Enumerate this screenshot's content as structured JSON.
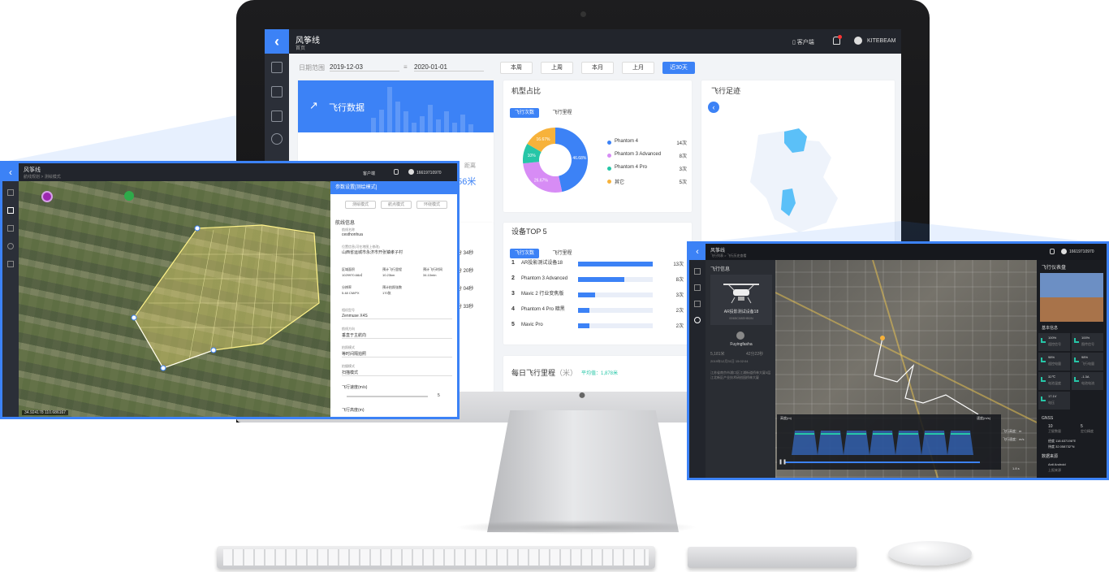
{
  "app": {
    "name": "风筝线",
    "subtitle": "首页",
    "client_label": "客户端",
    "user": "KITEBEAM"
  },
  "date_range": {
    "label": "日期范围",
    "start": "2019-12-03",
    "separator": "≡",
    "end": "2020-01-01"
  },
  "range_buttons": [
    {
      "label": "本周",
      "active": false
    },
    {
      "label": "上周",
      "active": false
    },
    {
      "label": "本月",
      "active": false
    },
    {
      "label": "上月",
      "active": false
    },
    {
      "label": "近30天",
      "active": true
    }
  ],
  "flight_data_card": {
    "title": "飞行数据",
    "partial_value": "356米",
    "partial_label": "距离"
  },
  "model_share": {
    "title": "机型占比",
    "tabs": [
      "飞行次数",
      "飞行里程"
    ],
    "pie_labels": [
      "46.68%",
      "26.67%",
      "16.67%",
      "10%"
    ],
    "legend": [
      {
        "name": "Phantom 4",
        "value": "14次",
        "color": "#3c82f6"
      },
      {
        "name": "Phantom 3 Advanced",
        "value": "8次",
        "color": "#d78cf5"
      },
      {
        "name": "Phantom 4 Pro",
        "value": "3次",
        "color": "#26c6a7"
      },
      {
        "name": "其它",
        "value": "5次",
        "color": "#f7b23b"
      }
    ]
  },
  "chart_data": {
    "type": "pie",
    "title": "机型占比",
    "categories": [
      "Phantom 4",
      "Phantom 3 Advanced",
      "Phantom 4 Pro",
      "其它"
    ],
    "values": [
      14,
      8,
      3,
      5
    ],
    "labels": [
      "46.68%",
      "26.67%",
      "10%",
      "16.67%"
    ]
  },
  "flight_track": {
    "title": "飞行足迹"
  },
  "device_top5": {
    "title": "设备TOP 5",
    "tabs": [
      "飞行次数",
      "飞行里程"
    ],
    "rows": [
      {
        "rank": "1",
        "name": "AR投影测试设备18",
        "value": "13次",
        "fraction": 1.0
      },
      {
        "rank": "2",
        "name": "Phantom 3 Advanced",
        "value": "8次",
        "fraction": 0.62
      },
      {
        "rank": "3",
        "name": "Mavic 2 行业变焦版",
        "value": "3次",
        "fraction": 0.23
      },
      {
        "rank": "4",
        "name": "Phantom 4 Pro 暗黑",
        "value": "2次",
        "fraction": 0.15
      },
      {
        "rank": "5",
        "name": "Mavic Pro",
        "value": "2次",
        "fraction": 0.15
      }
    ]
  },
  "daily_mileage": {
    "title": "每日飞行里程",
    "unit": "（米）",
    "avg": "平均值：1,878米"
  },
  "partial_durations": [
    "分 34秒",
    "分 20秒",
    "分 04秒",
    "分 33秒"
  ],
  "left_window": {
    "app_name": "风筝线",
    "breadcrumb": "航线规划 > 测绘模式",
    "client_label": "客户端",
    "phone": "16619710970",
    "panel_title": "参数设置[测绘模式]",
    "mode_buttons": [
      "测绘模式",
      "航点模式",
      "环绕模式"
    ],
    "section": "航线信息",
    "fields": [
      {
        "label": "航线名称",
        "value": "cesthonhua"
      },
      {
        "label": "位置信息(可在地图上修改)",
        "value": "山西省运城市永济市开张镇孝子村"
      }
    ],
    "stats": [
      {
        "label": "区域面积",
        "value": "1029970.68㎡"
      },
      {
        "label": "预计飞行里程",
        "value": "10.23km"
      },
      {
        "label": "预计飞行时间",
        "value": "34.10min"
      },
      {
        "label": "分辨率",
        "value": "5.48 CM/PX"
      },
      {
        "label": "预计拍照张数",
        "value": "170张"
      }
    ],
    "selects": [
      {
        "label": "相机型号",
        "value": "Zenmuse X4S"
      },
      {
        "label": "航线方向",
        "value": "垂直于主航向"
      },
      {
        "label": "拍照模式",
        "value": "等时间隔拍照"
      },
      {
        "label": "拍摄模式",
        "value": "扫描模式"
      }
    ],
    "sliders": [
      {
        "label": "飞行速度(m/s)",
        "value": "5"
      },
      {
        "label": "飞行高度(m)",
        "value": ""
      }
    ],
    "coords": "34.924178    110.686167"
  },
  "right_window": {
    "app_name": "风筝线",
    "breadcrumb": "飞行列表 > 飞行历史查看",
    "phone": "16619710970",
    "left_panel_title": "飞行信息",
    "device_name": "AR投影测试设备18",
    "serial": "0065C08EHB0N",
    "pilot": "Fuyingfasha",
    "distance": "5,181米",
    "duration": "42分22秒",
    "date": "2019年12月31日 15:02:04",
    "address": "江苏省南京市浦口区江浦街道桥林大厦3层江北新区产业技术研创园桥林大厦",
    "right_panel_title": "飞行仪表盘",
    "basic_info": "基本信息",
    "metrics": [
      {
        "value": "100%",
        "label": "遥控信号"
      },
      {
        "value": "100%",
        "label": "图传信号"
      },
      {
        "value": "98%",
        "label": "遥控电量"
      },
      {
        "value": "98%",
        "label": "飞行电量"
      },
      {
        "value": "32℃",
        "label": "电池温度"
      },
      {
        "value": "-1.3A",
        "label": "电池电流"
      },
      {
        "value": "17.1V",
        "label": "电压"
      }
    ],
    "gnss_title": "GNSS",
    "gnss": [
      {
        "value": "10",
        "label": "卫星数量"
      },
      {
        "value": "5",
        "label": "定位精度"
      }
    ],
    "lon": "经度  118.637196°E",
    "lat": "纬度  32.058732°N",
    "source_title": "数据来源",
    "source_value": "Anti Android",
    "source_label": "上报来源",
    "chart_left_label": "高度(m)",
    "chart_right_label": "速度(m/s)",
    "legend_alt": "飞行高度：m",
    "legend_speed": "飞行速度：m/s",
    "bottom_coords": "1.8 s"
  }
}
